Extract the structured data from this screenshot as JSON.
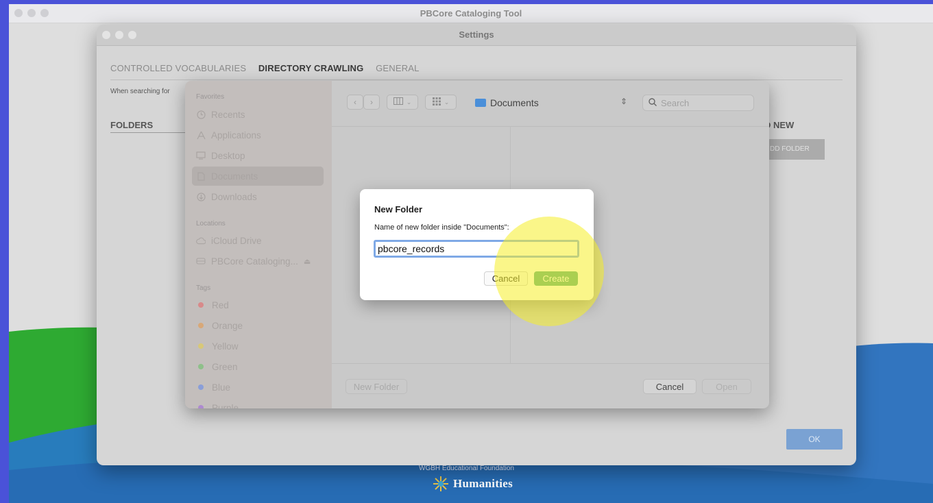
{
  "app": {
    "title": "PBCore Cataloging Tool"
  },
  "settings": {
    "title": "Settings",
    "tabs": [
      {
        "label": "CONTROLLED VOCABULARIES",
        "active": false
      },
      {
        "label": "DIRECTORY CRAWLING",
        "active": true
      },
      {
        "label": "GENERAL",
        "active": false
      }
    ],
    "hint_text": "When searching for",
    "folders_label": "FOLDERS",
    "add_new_label": "D NEW",
    "add_folder_button": "DD FOLDER",
    "ok_button": "OK"
  },
  "file_panel": {
    "sidebar": {
      "favorites_label": "Favorites",
      "favorites": [
        {
          "label": "Recents",
          "icon": "clock-icon"
        },
        {
          "label": "Applications",
          "icon": "applications-icon"
        },
        {
          "label": "Desktop",
          "icon": "desktop-icon"
        },
        {
          "label": "Documents",
          "icon": "document-icon",
          "selected": true
        },
        {
          "label": "Downloads",
          "icon": "download-icon"
        }
      ],
      "locations_label": "Locations",
      "locations": [
        {
          "label": "iCloud Drive",
          "icon": "cloud-icon"
        },
        {
          "label": "PBCore Cataloging...",
          "icon": "disk-icon",
          "eject": "⏏"
        }
      ],
      "tags_label": "Tags",
      "tags": [
        {
          "label": "Red",
          "color": "#d88a8a"
        },
        {
          "label": "Orange",
          "color": "#d8a878"
        },
        {
          "label": "Yellow",
          "color": "#d8c878"
        },
        {
          "label": "Green",
          "color": "#8ec08a"
        },
        {
          "label": "Blue",
          "color": "#8a9ed8"
        },
        {
          "label": "Purple",
          "color": "#ae8ad0"
        }
      ]
    },
    "toolbar": {
      "location": "Documents",
      "search_placeholder": "Search"
    },
    "bottom": {
      "new_folder_button": "New Folder",
      "cancel_button": "Cancel",
      "open_button": "Open"
    }
  },
  "dialog": {
    "title": "New Folder",
    "message": "Name of new folder inside \"Documents\":",
    "input_value": "pbcore_records",
    "cancel_button": "Cancel",
    "create_button": "Create"
  },
  "footer": {
    "text": "WGBH Educational Foundation",
    "logo_text": "Humanities"
  }
}
